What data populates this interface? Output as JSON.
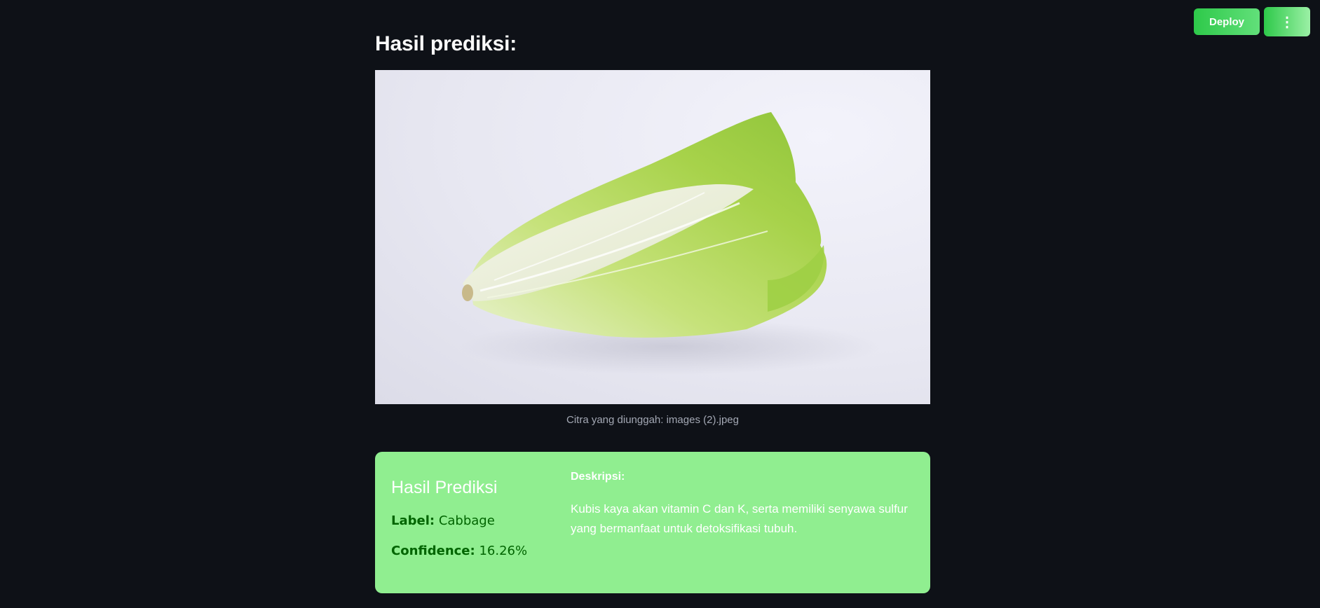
{
  "toolbar": {
    "deploy_label": "Deploy",
    "menu_icon": "vertical-ellipsis-icon",
    "menu_glyph": "⋮"
  },
  "main": {
    "title": "Hasil prediksi:",
    "image": {
      "subject": "napa cabbage",
      "caption": "Citra yang diunggah: images (2).jpeg"
    }
  },
  "result": {
    "heading": "Hasil Prediksi",
    "label_key": "Label:",
    "label_value": "Cabbage",
    "confidence_key": "Confidence:",
    "confidence_value": "16.26%",
    "description_title": "Deskripsi:",
    "description_text": "Kubis kaya akan vitamin C dan K, serta memiliki senyawa sulfur yang bermanfaat untuk detoksifikasi tubuh."
  },
  "colors": {
    "background": "#0e1117",
    "card": "#90ee90",
    "accent": "#2ec94a",
    "label_text": "#006400"
  }
}
